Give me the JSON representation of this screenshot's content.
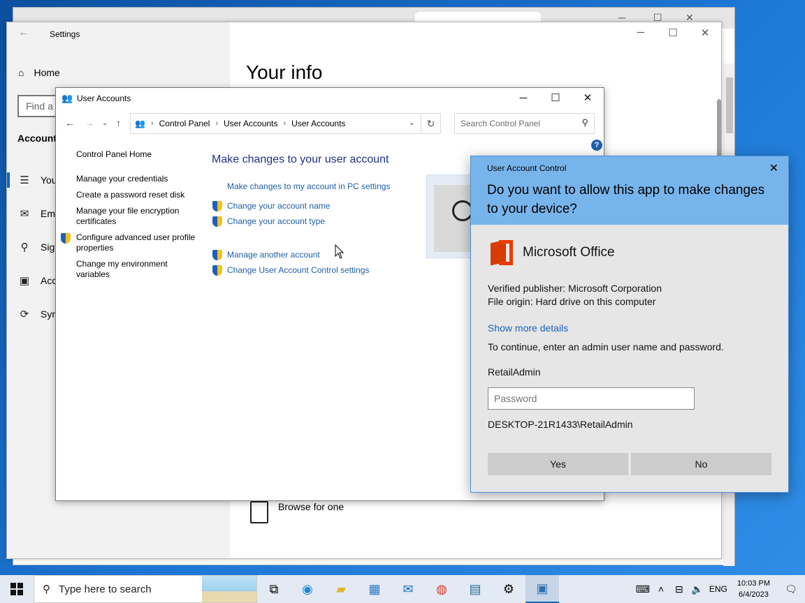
{
  "settings": {
    "title": "Settings",
    "home": "Home",
    "find_placeholder": "Find a s",
    "section": "Accounts",
    "nav": [
      "You",
      "Ema",
      "Sign",
      "Acc",
      "Sync"
    ],
    "heading": "Your info",
    "browse": "Browse for one"
  },
  "user_accounts": {
    "title": "User Accounts",
    "crumbs": [
      "Control Panel",
      "User Accounts",
      "User Accounts"
    ],
    "search_placeholder": "Search Control Panel",
    "left_links": [
      "Control Panel Home",
      "Manage your credentials",
      "Create a password reset disk",
      "Manage your file encryption certificates",
      "Configure advanced user profile properties",
      "Change my environment variables"
    ],
    "main_heading": "Make changes to your user account",
    "main_links": [
      "Make changes to my account in PC settings",
      "Change your account name",
      "Change your account type",
      "Manage another account",
      "Change User Account Control settings"
    ]
  },
  "uac": {
    "title": "User Account Control",
    "question": "Do you want to allow this app to make changes to your device?",
    "app_name": "Microsoft Office",
    "publisher": "Verified publisher: Microsoft Corporation",
    "origin": "File origin: Hard drive on this computer",
    "more_details": "Show more details",
    "instructions": "To continue, enter an admin user name and password.",
    "username": "RetailAdmin",
    "password_placeholder": "Password",
    "domain_user": "DESKTOP-21R1433\\RetailAdmin",
    "yes": "Yes",
    "no": "No"
  },
  "taskbar": {
    "search_placeholder": "Type here to search",
    "language": "ENG",
    "time": "10:03 PM",
    "date": "6/4/2023"
  }
}
